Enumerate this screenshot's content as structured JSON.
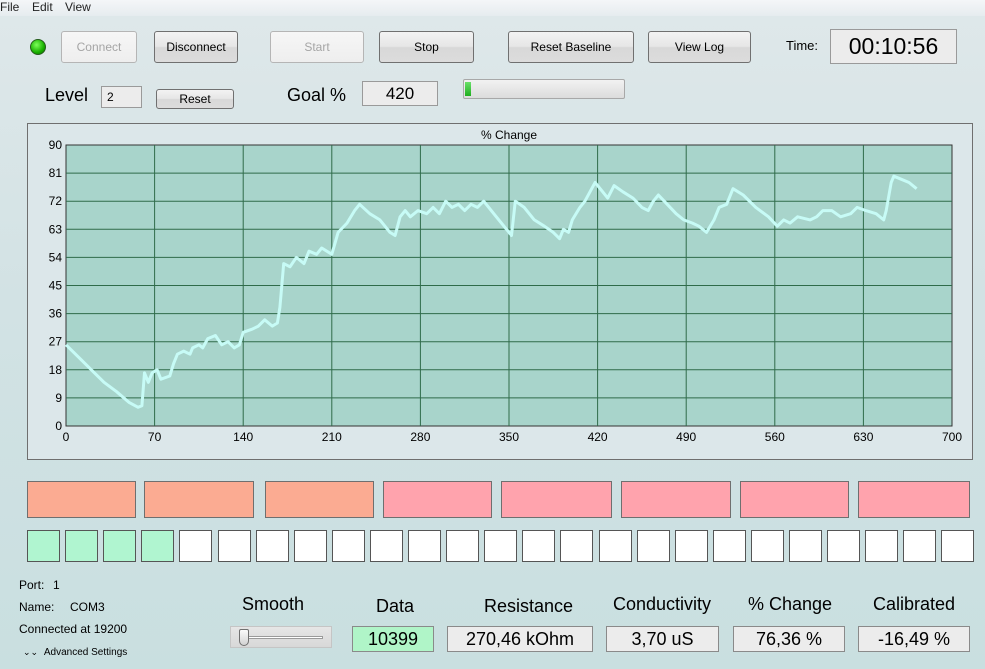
{
  "menu": {
    "file": "File",
    "edit": "Edit",
    "view": "View"
  },
  "toolbar": {
    "connect": "Connect",
    "disconnect": "Disconnect",
    "start": "Start",
    "stop": "Stop",
    "reset_baseline": "Reset Baseline",
    "view_log": "View Log",
    "time_label": "Time:",
    "time_value": "00:10:56"
  },
  "status_led": {
    "color": "#22c000",
    "state": "connected"
  },
  "level": {
    "label": "Level",
    "value": "2",
    "reset": "Reset"
  },
  "goal": {
    "label": "Goal %",
    "value": "420",
    "progress_fraction": 0.03
  },
  "colors": {
    "plot_bg": "#a8d4cb",
    "line": "#c7fbf6",
    "grid": "#2f6b4a",
    "segment_orange": "#fbab92",
    "segment_pink": "#ffa3ad",
    "square_green": "#b0f5d0",
    "square_white": "#ffffff"
  },
  "chart_data": {
    "type": "line",
    "title": "% Change",
    "xlabel": "",
    "ylabel": "",
    "xlim": [
      0,
      700
    ],
    "ylim": [
      0,
      90
    ],
    "xticks": [
      "0",
      "70",
      "140",
      "210",
      "280",
      "350",
      "420",
      "490",
      "560",
      "630",
      "700"
    ],
    "yticks": [
      "0",
      "9",
      "18",
      "27",
      "36",
      "45",
      "54",
      "63",
      "72",
      "81",
      "90"
    ],
    "grid": true,
    "series": [
      {
        "values_xy": [
          [
            0,
            26
          ],
          [
            10,
            22
          ],
          [
            20,
            18
          ],
          [
            30,
            14
          ],
          [
            40,
            11
          ],
          [
            50,
            7.5
          ],
          [
            57,
            6
          ],
          [
            60,
            6.5
          ],
          [
            62,
            17
          ],
          [
            65,
            14
          ],
          [
            68,
            17
          ],
          [
            72,
            18
          ],
          [
            75,
            15
          ],
          [
            82,
            16
          ],
          [
            85,
            20
          ],
          [
            88,
            23
          ],
          [
            93,
            24
          ],
          [
            98,
            23
          ],
          [
            100,
            25
          ],
          [
            105,
            26
          ],
          [
            108,
            25
          ],
          [
            112,
            28
          ],
          [
            118,
            29
          ],
          [
            123,
            26
          ],
          [
            128,
            27
          ],
          [
            133,
            25
          ],
          [
            137,
            26
          ],
          [
            140,
            30
          ],
          [
            147,
            31
          ],
          [
            152,
            32
          ],
          [
            157,
            34
          ],
          [
            163,
            32
          ],
          [
            167,
            33
          ],
          [
            169,
            38
          ],
          [
            172,
            52
          ],
          [
            177,
            51
          ],
          [
            182,
            54
          ],
          [
            188,
            52
          ],
          [
            192,
            56
          ],
          [
            198,
            55
          ],
          [
            202,
            57
          ],
          [
            210,
            55
          ],
          [
            215,
            62
          ],
          [
            222,
            65
          ],
          [
            228,
            69
          ],
          [
            232,
            71
          ],
          [
            240,
            68
          ],
          [
            248,
            66
          ],
          [
            256,
            62
          ],
          [
            260,
            61
          ],
          [
            264,
            67
          ],
          [
            268,
            69
          ],
          [
            272,
            67
          ],
          [
            278,
            69
          ],
          [
            285,
            68
          ],
          [
            290,
            70
          ],
          [
            295,
            68
          ],
          [
            300,
            72
          ],
          [
            305,
            70
          ],
          [
            310,
            71
          ],
          [
            315,
            69
          ],
          [
            320,
            71
          ],
          [
            325,
            70
          ],
          [
            330,
            72
          ],
          [
            340,
            67
          ],
          [
            348,
            63
          ],
          [
            352,
            61
          ],
          [
            355,
            72
          ],
          [
            362,
            70
          ],
          [
            370,
            66
          ],
          [
            378,
            64
          ],
          [
            385,
            62
          ],
          [
            390,
            60
          ],
          [
            393,
            63
          ],
          [
            397,
            62
          ],
          [
            400,
            66
          ],
          [
            406,
            70
          ],
          [
            410,
            72
          ],
          [
            414,
            75
          ],
          [
            418,
            78
          ],
          [
            424,
            75
          ],
          [
            428,
            73
          ],
          [
            433,
            77
          ],
          [
            440,
            75
          ],
          [
            448,
            73
          ],
          [
            455,
            70
          ],
          [
            460,
            69
          ],
          [
            464,
            72
          ],
          [
            468,
            74
          ],
          [
            475,
            71
          ],
          [
            482,
            68
          ],
          [
            488,
            66
          ],
          [
            495,
            65
          ],
          [
            500,
            64
          ],
          [
            506,
            62
          ],
          [
            512,
            66
          ],
          [
            516,
            70
          ],
          [
            522,
            71
          ],
          [
            527,
            76
          ],
          [
            535,
            74
          ],
          [
            545,
            70
          ],
          [
            555,
            67
          ],
          [
            562,
            64
          ],
          [
            567,
            66
          ],
          [
            572,
            65
          ],
          [
            578,
            67
          ],
          [
            588,
            66
          ],
          [
            593,
            67
          ],
          [
            598,
            69
          ],
          [
            605,
            69
          ],
          [
            612,
            67
          ],
          [
            620,
            68
          ],
          [
            625,
            70
          ],
          [
            632,
            69
          ],
          [
            640,
            68
          ],
          [
            646,
            66
          ],
          [
            648,
            69
          ],
          [
            652,
            78
          ],
          [
            654,
            80
          ],
          [
            660,
            79
          ],
          [
            666,
            78
          ],
          [
            672,
            76
          ]
        ]
      }
    ]
  },
  "segments": [
    {
      "color": "orange"
    },
    {
      "color": "orange"
    },
    {
      "color": "orange"
    },
    {
      "color": "pink"
    },
    {
      "color": "pink"
    },
    {
      "color": "pink"
    },
    {
      "color": "pink"
    },
    {
      "color": "pink"
    }
  ],
  "squares": {
    "total": 25,
    "filled": 4
  },
  "port": {
    "port_label": "Port:",
    "port_value": "1",
    "name_label": "Name:",
    "name_value": "COM3",
    "connected": "Connected at 19200",
    "advanced": "Advanced Settings"
  },
  "smooth": {
    "label": "Smooth",
    "level": 0.0
  },
  "meters": {
    "data": {
      "label": "Data",
      "value": "10399"
    },
    "resistance": {
      "label": "Resistance",
      "value": "270,46 kOhm"
    },
    "conductivity": {
      "label": "Conductivity",
      "value": "3,70 uS"
    },
    "pct_change": {
      "label": "% Change",
      "value": "76,36 %"
    },
    "calibrated": {
      "label": "Calibrated",
      "value": "-16,49 %"
    }
  }
}
